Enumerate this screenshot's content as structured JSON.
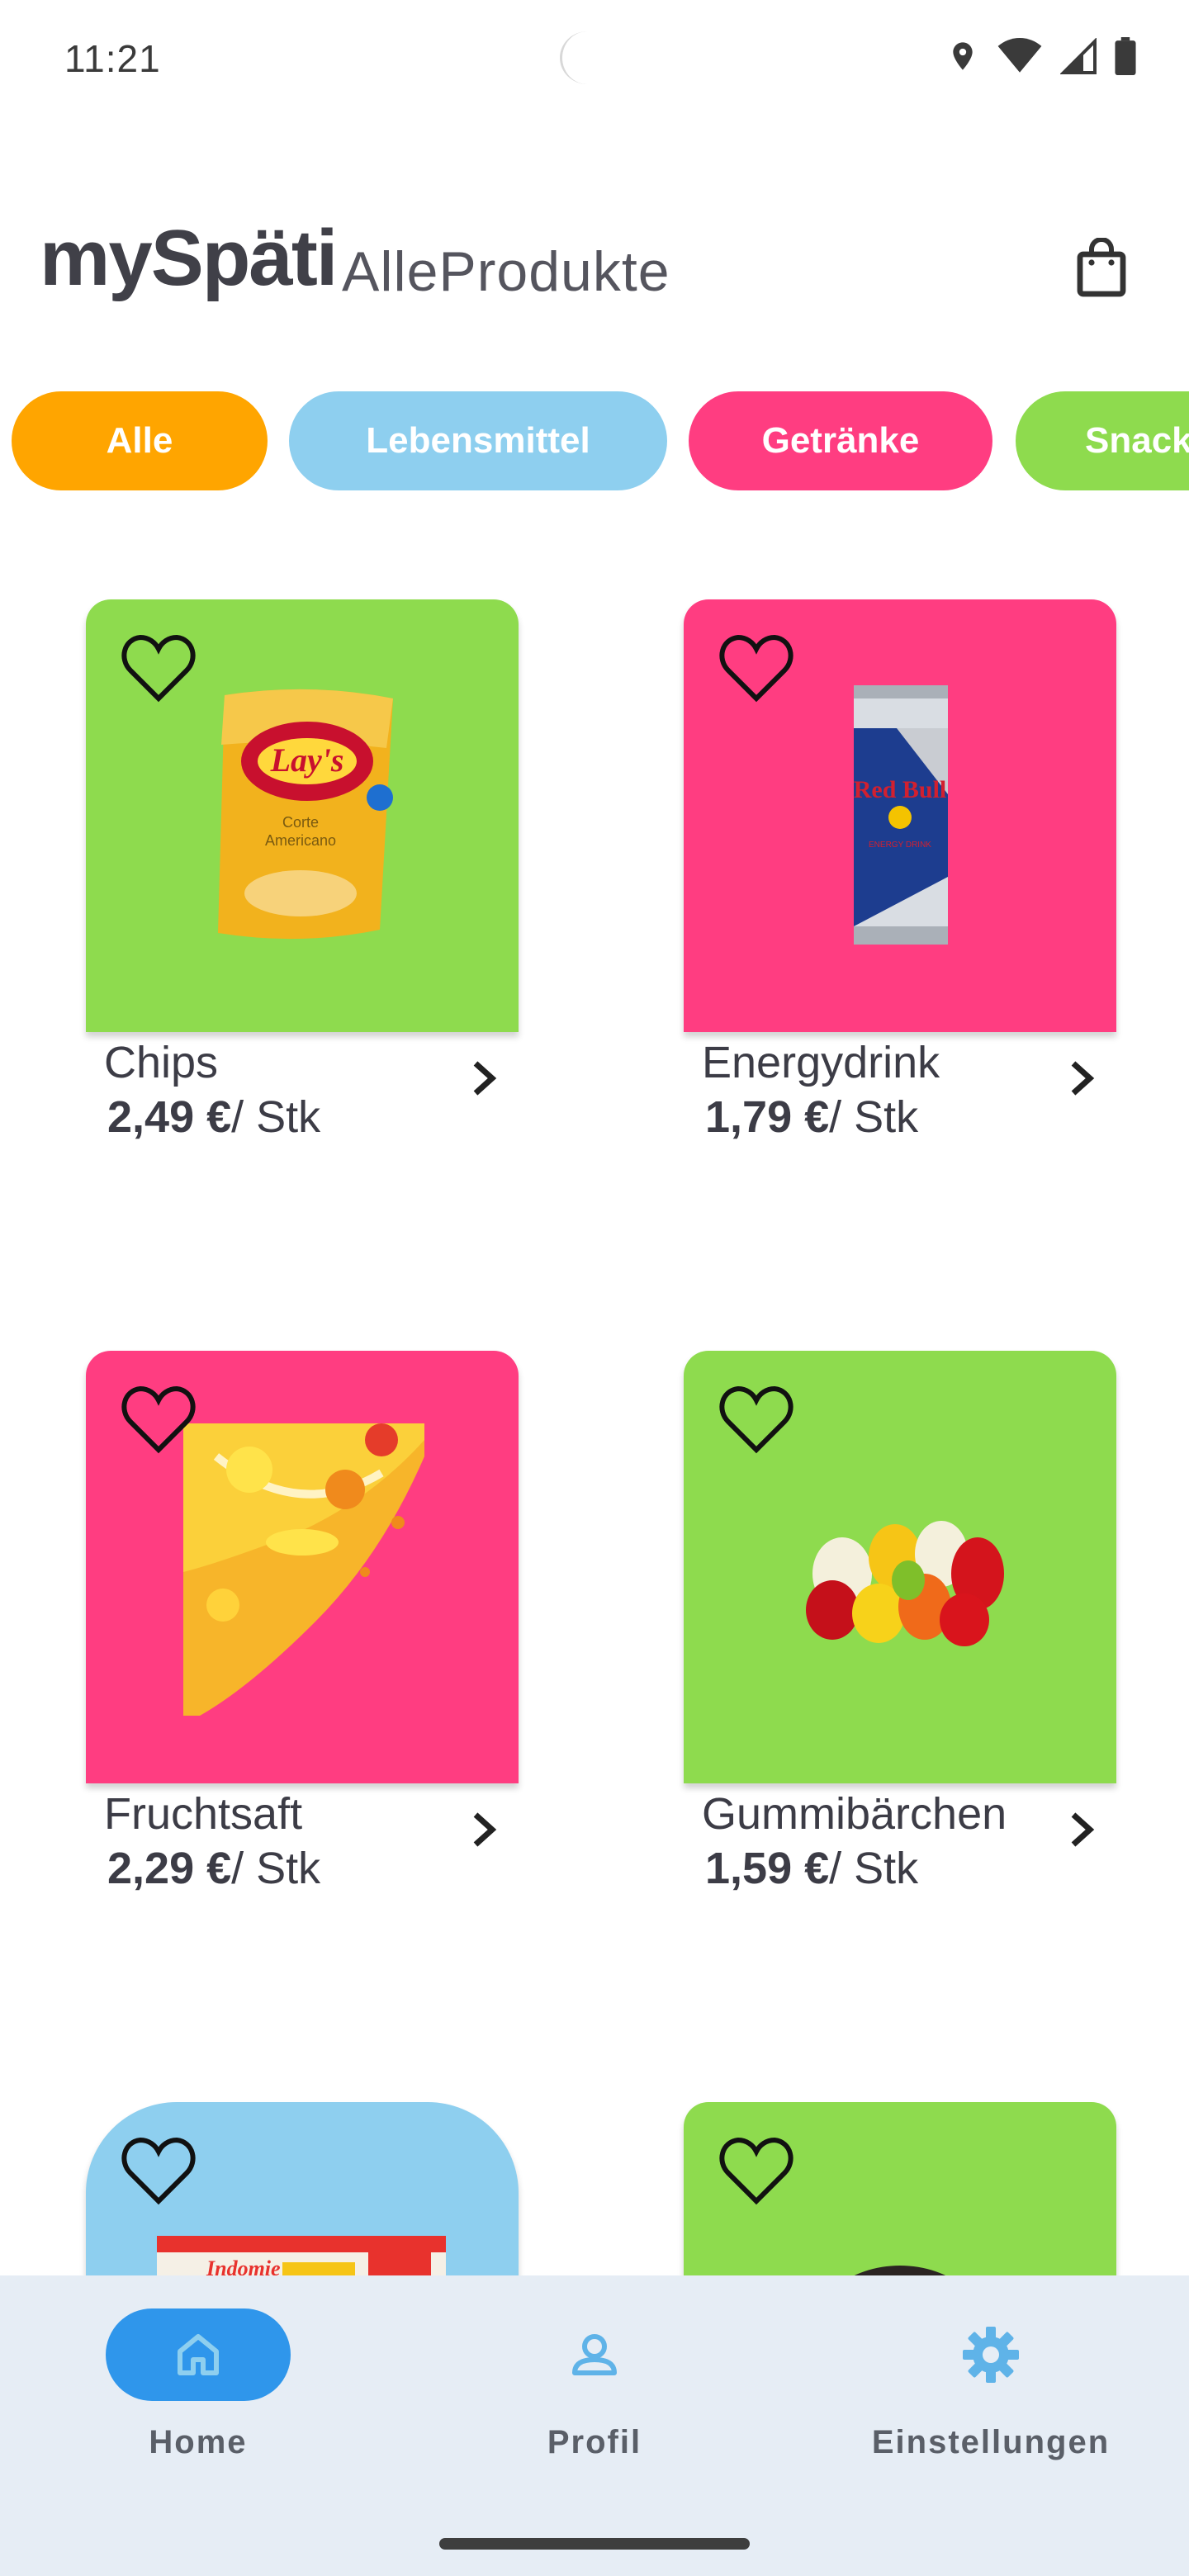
{
  "status": {
    "time": "11:21"
  },
  "header": {
    "brand": "mySpäti",
    "subtitle": "AlleProdukte"
  },
  "categories": [
    {
      "label": "Alle",
      "color": "#FFA500"
    },
    {
      "label": "Lebensmittel",
      "color": "#8ECFEF"
    },
    {
      "label": "Getränke",
      "color": "#FF3D81"
    },
    {
      "label": "Snacks",
      "color": "#8EDB4E"
    }
  ],
  "products": [
    {
      "name": "Chips",
      "price": "2,49 €",
      "unit": "/ Stk",
      "bg": "#8EDB4E",
      "image": "chips-bag"
    },
    {
      "name": "Energydrink",
      "price": "1,79 €",
      "unit": "/ Stk",
      "bg": "#FF3D81",
      "image": "energy-can"
    },
    {
      "name": "Fruchtsaft",
      "price": "2,29 €",
      "unit": "/ Stk",
      "bg": "#FF3D81",
      "image": "juice-splash"
    },
    {
      "name": "Gummibärchen",
      "price": "1,59 €",
      "unit": "/ Stk",
      "bg": "#8EDB4E",
      "image": "gummy-bears"
    },
    {
      "name": "",
      "price": "",
      "unit": "",
      "bg": "#8ECFEF",
      "image": "noodle-pack"
    },
    {
      "name": "",
      "price": "",
      "unit": "",
      "bg": "#8EDB4E",
      "image": "cookie"
    }
  ],
  "nav": {
    "items": [
      {
        "label": "Home",
        "icon": "home-icon",
        "active": true
      },
      {
        "label": "Profil",
        "icon": "person-icon",
        "active": false
      },
      {
        "label": "Einstellungen",
        "icon": "gear-icon",
        "active": false
      }
    ],
    "active_color": "#2F96EB",
    "icon_color": "#5FB3E8"
  }
}
